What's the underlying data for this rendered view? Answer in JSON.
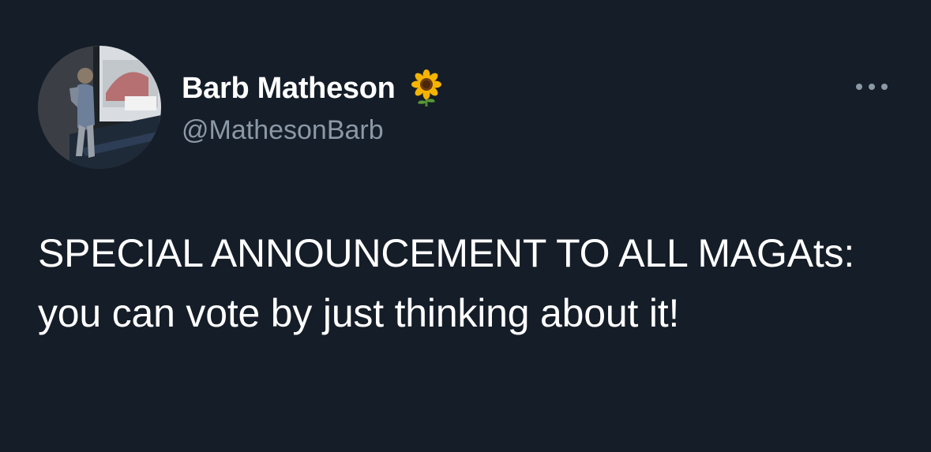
{
  "tweet": {
    "author": {
      "display_name": "Barb Matheson",
      "handle": "@MathesonBarb",
      "name_emoji": "sunflower-emoji",
      "avatar": "avatar-photo"
    },
    "more_icon": "more-horizontal-icon",
    "text": "SPECIAL ANNOUNCEMENT TO ALL MAGAts: you can vote by just thinking about it!"
  },
  "colors": {
    "background": "#151d28",
    "text_primary": "#ffffff",
    "text_secondary": "#8b98a5"
  }
}
